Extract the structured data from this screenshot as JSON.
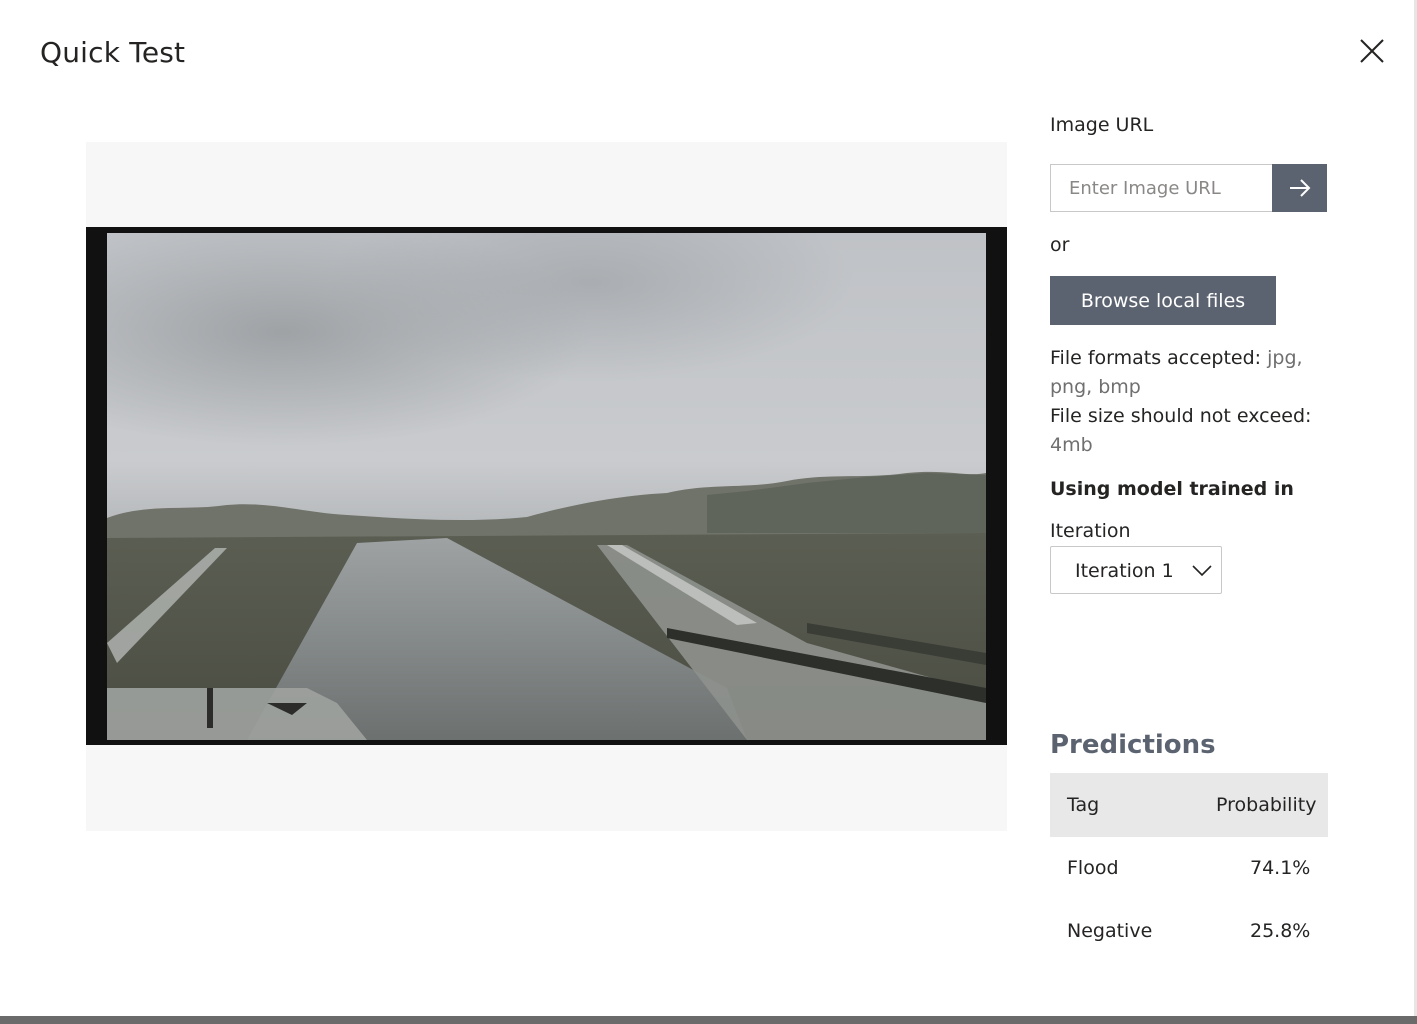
{
  "dialog": {
    "title": "Quick Test",
    "close_icon": "close-icon"
  },
  "preview": {
    "image_alt": "Rainy road with water under an overcast sky"
  },
  "image_url": {
    "label": "Image URL",
    "placeholder": "Enter Image URL",
    "value": "",
    "submit_icon": "arrow-right-icon"
  },
  "or_text": "or",
  "browse": {
    "label": "Browse local files"
  },
  "file_info": {
    "formats_label": "File formats accepted:",
    "formats_value": "jpg, png, bmp",
    "size_label": "File size should not exceed:",
    "size_value": "4mb"
  },
  "model": {
    "heading": "Using model trained in",
    "iteration_label": "Iteration",
    "selected_iteration": "Iteration 1",
    "dropdown_icon": "chevron-down-icon"
  },
  "predictions": {
    "title": "Predictions",
    "columns": [
      "Tag",
      "Probability"
    ],
    "rows": [
      {
        "tag": "Flood",
        "probability": "74.1%"
      },
      {
        "tag": "Negative",
        "probability": "25.8%"
      }
    ]
  },
  "colors": {
    "accent_button": "#5c6370",
    "table_header": "#e8e8e8",
    "muted_text": "#6f6f6f"
  }
}
